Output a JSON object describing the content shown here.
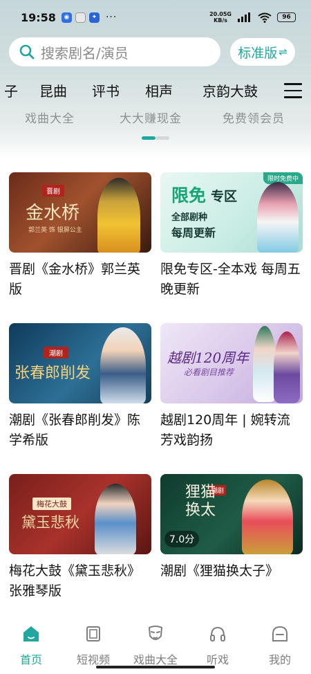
{
  "status_bar": {
    "time": "19:58",
    "more": "···",
    "net_speed_value": "20.0",
    "net_speed_unit": "KB/s",
    "net_type": "5G",
    "battery": "96"
  },
  "search": {
    "placeholder": "搜索剧名/演员",
    "edition_label": "标准版",
    "edition_swap": "⇌"
  },
  "categories": [
    "子",
    "昆曲",
    "评书",
    "相声",
    "京韵大鼓"
  ],
  "banner_texts": [
    "戏曲大全",
    "大大赚现金",
    "免费领会员"
  ],
  "cards": [
    {
      "title": "晋剧《金水桥》郭兰英版",
      "thumb_tag": "晋剧",
      "thumb_title": "金水桥",
      "thumb_sub": "郭兰英 饰 银屏公主"
    },
    {
      "title": "限免专区-全本戏 每周五晚更新",
      "thumb_tag": "限时免费中",
      "thumb_title_a": "限免",
      "thumb_title_b": "专区",
      "thumb_line1": "全部剧种",
      "thumb_line2": "每周更新"
    },
    {
      "title": "潮剧《张春郎削发》陈学希版",
      "thumb_tag": "潮剧",
      "thumb_title": "张春郎削发"
    },
    {
      "title": "越剧120周年 | 婉转流芳戏韵扬",
      "thumb_title": "越剧120周年",
      "thumb_sub": "必看剧目推荐"
    },
    {
      "title": "梅花大鼓《黛玉悲秋》张雅琴版",
      "thumb_tag": "梅花大鼓",
      "thumb_title": "黛玉悲秋"
    },
    {
      "title": "潮剧《狸猫换太子》",
      "thumb_tag": "潮剧",
      "thumb_title": "狸猫换太",
      "rating": "7.0分"
    }
  ],
  "bottom_nav": [
    {
      "label": "首页",
      "icon": "home-icon",
      "active": true
    },
    {
      "label": "短视频",
      "icon": "video-icon",
      "active": false
    },
    {
      "label": "戏曲大全",
      "icon": "opera-mask-icon",
      "active": false
    },
    {
      "label": "听戏",
      "icon": "headphones-icon",
      "active": false
    },
    {
      "label": "我的",
      "icon": "profile-icon",
      "active": false
    }
  ],
  "colors": {
    "accent": "#1fa7a0",
    "inactive": "#7e7e7e"
  }
}
